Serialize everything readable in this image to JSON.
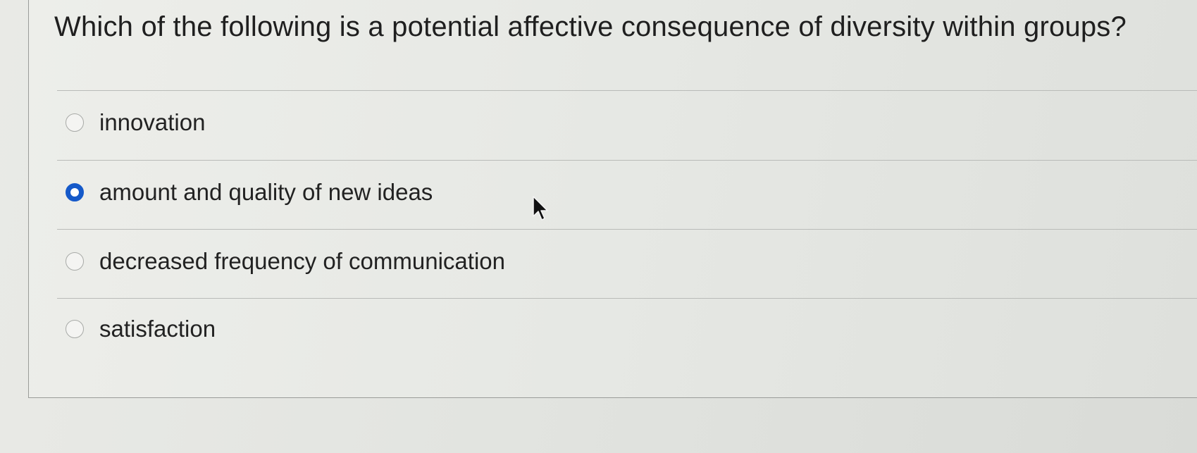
{
  "question": {
    "text": "Which of the following is a potential affective consequence of diversity within groups?"
  },
  "options": [
    {
      "label": "innovation",
      "selected": false
    },
    {
      "label": "amount and quality of new ideas",
      "selected": true
    },
    {
      "label": "decreased frequency of communication",
      "selected": false
    },
    {
      "label": "satisfaction",
      "selected": false
    }
  ],
  "colors": {
    "selected_radio": "#1559c9",
    "text": "#222222"
  },
  "icons": {
    "pointer": "mouse-pointer-icon"
  }
}
